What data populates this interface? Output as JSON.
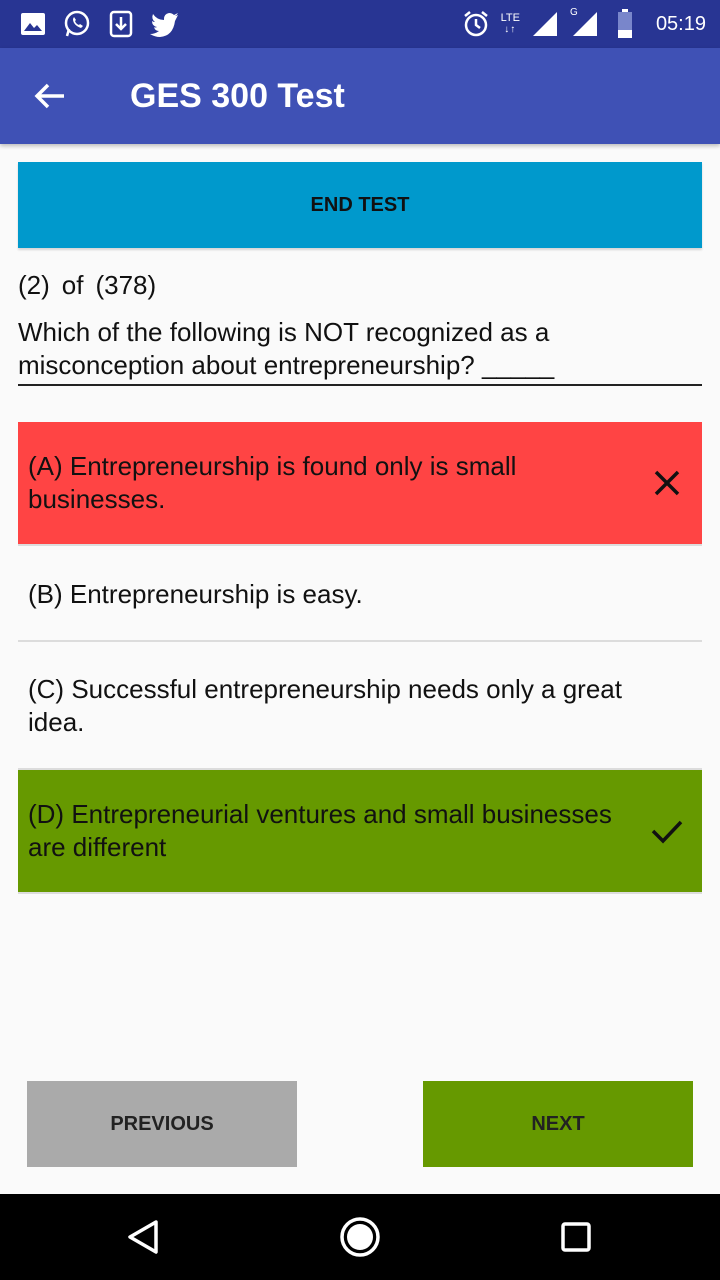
{
  "status_bar": {
    "time": "05:19",
    "network_label": "LTE",
    "network_arrows": "↓↑",
    "secondary_network": "G",
    "left_icons": [
      "image-icon",
      "whatsapp-icon",
      "download-icon",
      "twitter-icon"
    ],
    "right_icons": [
      "alarm-icon",
      "signal-icon",
      "signal-g-icon",
      "battery-icon"
    ]
  },
  "app_bar": {
    "title": "GES 300 Test",
    "back_icon": "back-arrow-icon",
    "color": "#3f51b5"
  },
  "end_test_label": "END TEST",
  "question": {
    "current": "(2)",
    "of": "of",
    "total": "(378)",
    "text": "Which of the following is NOT recognized as a misconception about entrepreneurship? _____"
  },
  "options": [
    {
      "text": "(A) Entrepreneurship is found only is small businesses.",
      "state": "wrong",
      "icon": "close-icon",
      "color": "#ff4444"
    },
    {
      "text": "(B) Entrepreneurship is easy.",
      "state": "neutral"
    },
    {
      "text": "(C) Successful entrepreneurship needs only a great idea.",
      "state": "neutral"
    },
    {
      "text": "(D) Entrepreneurial ventures and small businesses are different",
      "state": "correct",
      "icon": "check-icon",
      "color": "#669900"
    }
  ],
  "nav": {
    "previous_label": "PREVIOUS",
    "next_label": "NEXT"
  },
  "system_nav": [
    "back-triangle-icon",
    "home-circle-icon",
    "recents-square-icon"
  ]
}
